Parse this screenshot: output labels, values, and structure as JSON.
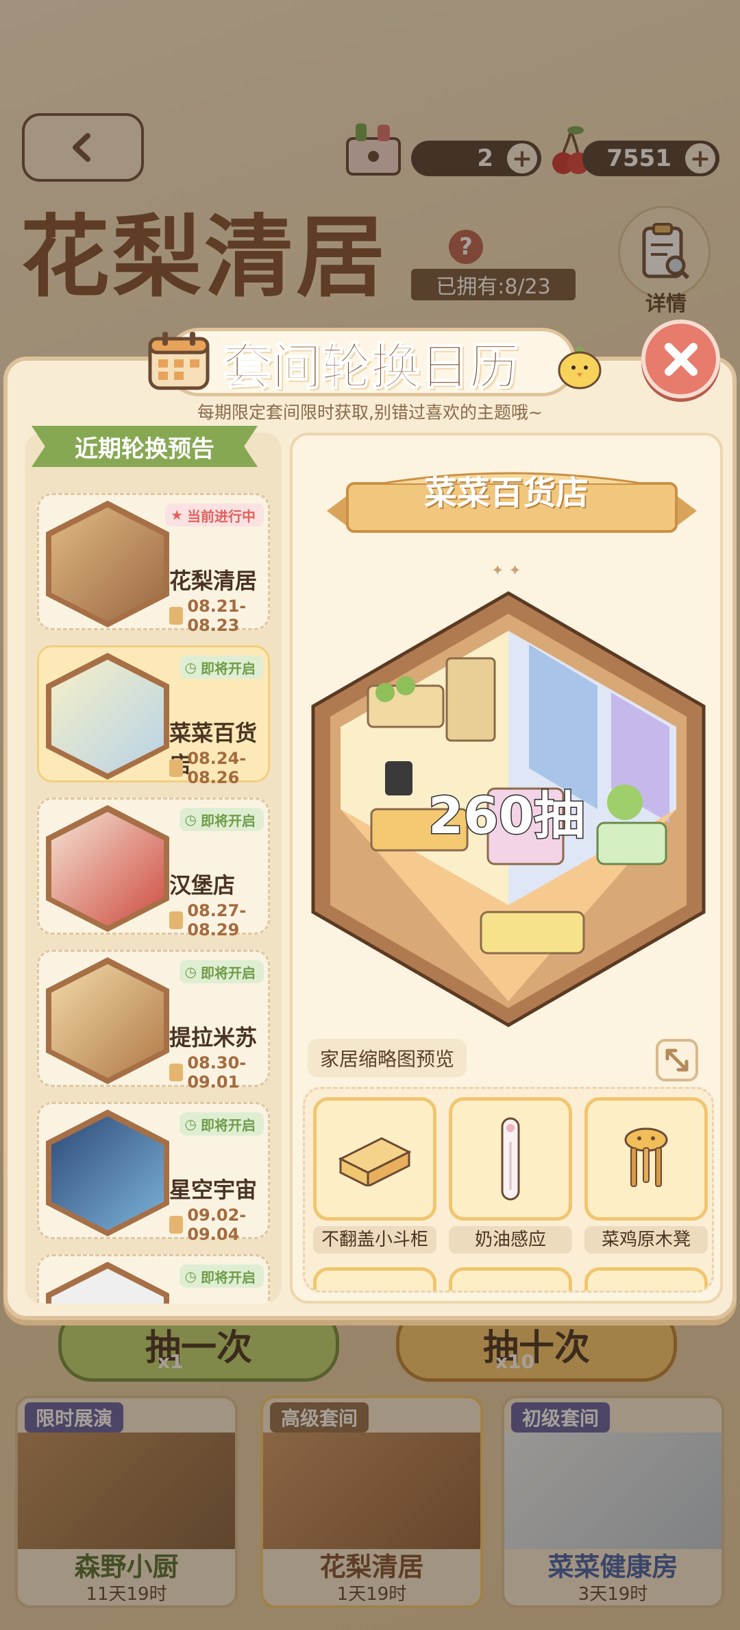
{
  "colors": {
    "accent_green": "#86a853",
    "accent_brown": "#7a4a2a",
    "close_red": "#e77b6c",
    "status_current": "#e0615d",
    "status_soon": "#6f9c49"
  },
  "background": {
    "title": "花梨清居",
    "owned": "已拥有:8/23",
    "detail_label": "详情",
    "currency": [
      {
        "icon": "gift-box-icon",
        "value": "2"
      },
      {
        "icon": "cherry-icon",
        "value": "7551"
      }
    ],
    "draw_buttons": [
      {
        "label": "抽一次",
        "count": "x1"
      },
      {
        "label": "抽十次",
        "count": "x10"
      }
    ],
    "cards": [
      {
        "tag": "限时展演",
        "tag_color": "#5a5aa0",
        "name": "森野小厨",
        "time": "11天19时",
        "name_color": "#4a6a2a"
      },
      {
        "tag": "高级套间",
        "tag_color": "#8a6a45",
        "name": "花梨清居",
        "time": "1天19时",
        "name_color": "#7a4a2a"
      },
      {
        "tag": "初级套间",
        "tag_color": "#5a5aa0",
        "name": "菜菜健康房",
        "time": "3天19时",
        "name_color": "#3a5aa8"
      }
    ]
  },
  "modal": {
    "title": "套间轮换日历",
    "subtitle": "每期限定套间限时获取,别错过喜欢的主题哦~",
    "list_header": "近期轮换预告",
    "schedule": [
      {
        "name": "花梨清居",
        "date": "08.21-08.23",
        "status": "当前进行中",
        "status_type": "current",
        "hex": "#c8955f",
        "selected": false
      },
      {
        "name": "菜菜百货店",
        "date": "08.24-08.26",
        "status": "即将开启",
        "status_type": "soon",
        "hex": "#e9dca6",
        "selected": true
      },
      {
        "name": "汉堡店",
        "date": "08.27-08.29",
        "status": "即将开启",
        "status_type": "soon",
        "hex": "#d96a5c",
        "selected": false
      },
      {
        "name": "提拉米苏",
        "date": "08.30-09.01",
        "status": "即将开启",
        "status_type": "soon",
        "hex": "#d9a86a",
        "selected": false
      },
      {
        "name": "星空宇宙",
        "date": "09.02-09.04",
        "status": "即将开启",
        "status_type": "soon",
        "hex": "#3d5a8a",
        "selected": false
      },
      {
        "name": "",
        "date": "",
        "status": "即将开启",
        "status_type": "soon",
        "hex": "#ececec",
        "selected": false
      }
    ],
    "detail": {
      "room_name": "菜菜百货店",
      "pull_count": "260抽",
      "preview_label": "家居缩略图预览",
      "items": [
        {
          "name": "不翻盖小斗柜",
          "icon": "cabinet-icon"
        },
        {
          "name": "奶油感应",
          "icon": "light-stick-icon"
        },
        {
          "name": "菜鸡原木凳",
          "icon": "stool-icon"
        }
      ]
    }
  }
}
